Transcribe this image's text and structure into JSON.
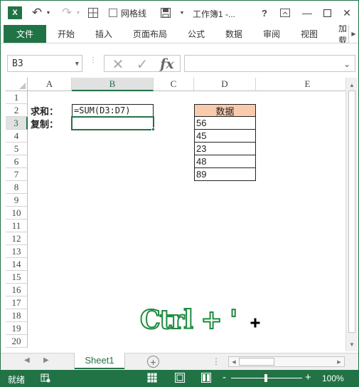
{
  "window": {
    "app_logo": "X",
    "gridlines_label": "网格线",
    "doc_title": "工作簿1 -...",
    "help": "?",
    "minimize": "—",
    "close": "✕"
  },
  "ribbon": {
    "tabs": [
      {
        "label": "文件",
        "active": true
      },
      {
        "label": "开始"
      },
      {
        "label": "插入"
      },
      {
        "label": "页面布局"
      },
      {
        "label": "公式"
      },
      {
        "label": "数据"
      },
      {
        "label": "审阅"
      },
      {
        "label": "视图"
      },
      {
        "label": "加载"
      }
    ]
  },
  "formula_bar": {
    "name_box": "B3",
    "cancel_icon": "✕",
    "enter_icon": "✓",
    "fx_label": "fx",
    "formula": ""
  },
  "grid": {
    "columns": [
      "A",
      "B",
      "C",
      "D",
      "E"
    ],
    "selected_column": "B",
    "rows": [
      "1",
      "2",
      "3",
      "4",
      "5",
      "6",
      "7",
      "8",
      "9",
      "10",
      "11",
      "12",
      "13",
      "14",
      "15",
      "16",
      "17",
      "18",
      "19",
      "20"
    ],
    "selected_row": "3",
    "cells": {
      "A2": "求和：",
      "B2": "=SUM(D3:D7)",
      "A3": "复制：",
      "D2": "数据",
      "D3": "56",
      "D4": "45",
      "D5": "23",
      "D6": "48",
      "D7": "89"
    },
    "active_cell": "B3",
    "shortcut_overlay": "Ctrl + '"
  },
  "sheets": {
    "tabs": [
      "Sheet1"
    ],
    "active": "Sheet1",
    "add_label": "+"
  },
  "status": {
    "text": "就绪",
    "zoom_minus": "-",
    "zoom_plus": "+",
    "zoom_level": "100%",
    "zoom_percent": 100
  },
  "colors": {
    "accent": "#217346",
    "header_fill": "#f8cbad",
    "overlay_text": "#1e8a3f"
  }
}
